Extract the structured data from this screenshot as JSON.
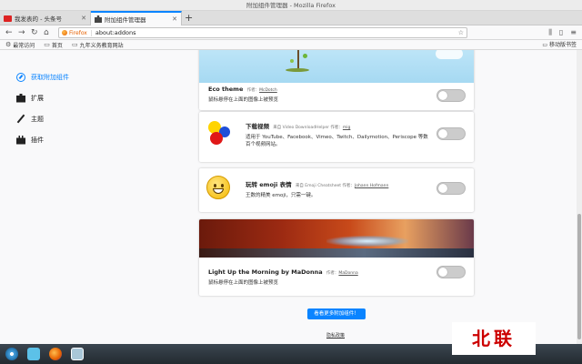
{
  "window": {
    "title": "附加组件管理器 - Mozilla Firefox"
  },
  "tabs": [
    {
      "label": "我发表的 - 头条号"
    },
    {
      "label": "附加组件管理器"
    }
  ],
  "navbar": {
    "badge": "Firefox",
    "url": "about:addons"
  },
  "bookmarks": {
    "items": [
      {
        "label": "最常访问"
      },
      {
        "label": "首页"
      },
      {
        "label": "九年义务教育网站"
      }
    ],
    "mobile": "移动版书签"
  },
  "sidebar": {
    "items": [
      {
        "label": "获取附加组件"
      },
      {
        "label": "扩展"
      },
      {
        "label": "主题"
      },
      {
        "label": "插件"
      }
    ]
  },
  "addons": [
    {
      "name": "Eco theme",
      "by_label": "作者：",
      "author": "McDotch",
      "desc": "鼠标悬停在上面的图像上被预览"
    },
    {
      "name": "下载视频",
      "by_label": "来自 Video DownloadHelper 作者：",
      "author": "mig",
      "desc": "适用于 YouTube、Facebook、Vimeo、Twitch、Dailymotion、Periscope 等数百个视频网站。"
    },
    {
      "name": "玩转 emoji 表情",
      "by_label": "来自 Emoji Cheatsheet 作者：",
      "author": "Johann Hofmann",
      "desc": "王数的精美 emoji，只需一键。"
    },
    {
      "name": "Light Up the Morning by MaDonna",
      "by_label": "作者：",
      "author": "MaDonna",
      "desc": "鼠标悬停在上面的图像上被预览"
    }
  ],
  "footer": {
    "more_button": "看看更多附加组件！",
    "privacy": "隐私政策"
  },
  "watermark": "北联",
  "icons": {
    "tab1": "toutiao-icon",
    "tab2": "puzzle-icon",
    "sidebar": [
      "compass-icon",
      "puzzle-icon",
      "brush-icon",
      "plugin-icon"
    ]
  },
  "colors": {
    "accent": "#0a84ff",
    "watermark": "#cc0000"
  }
}
